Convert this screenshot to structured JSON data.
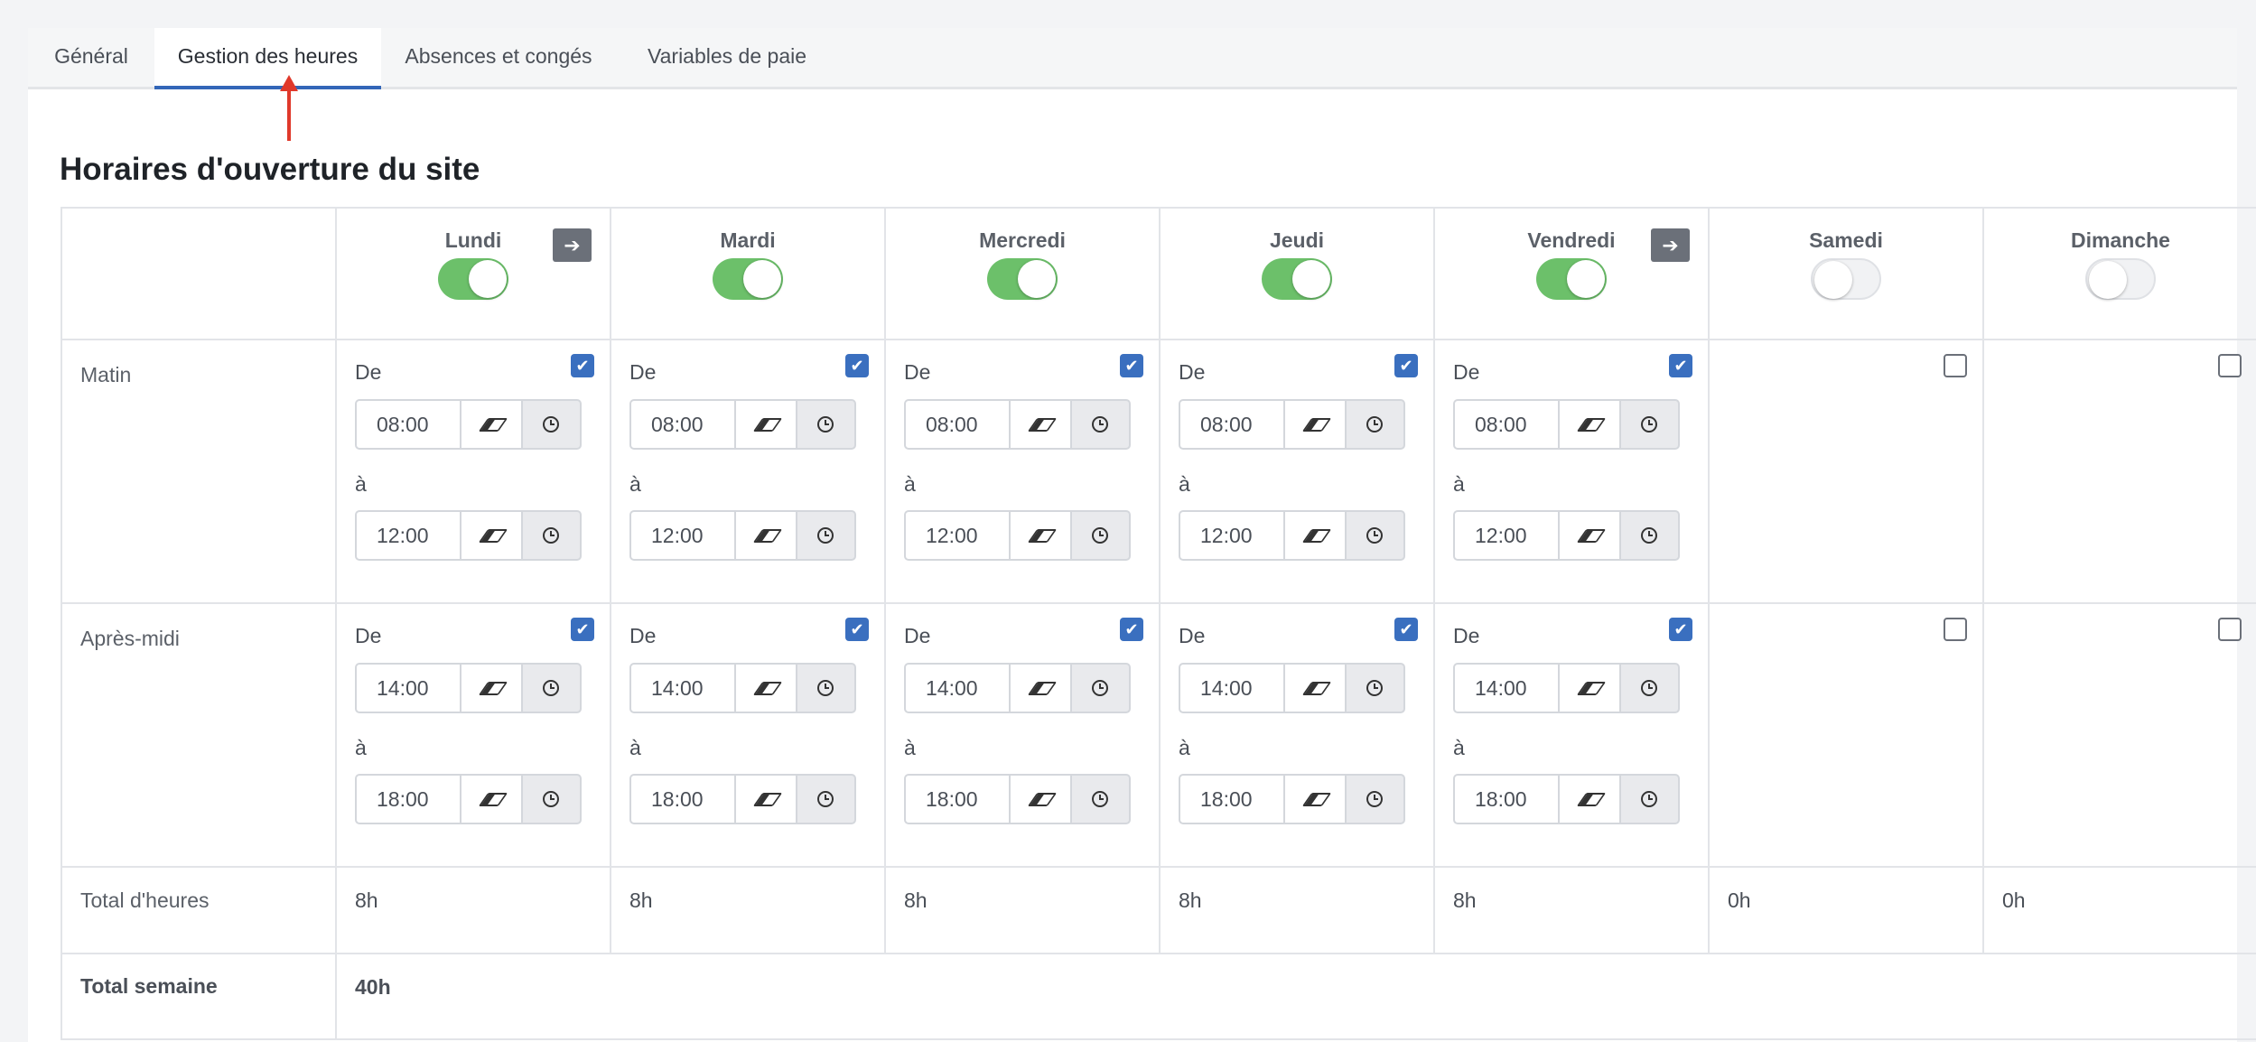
{
  "tabs": [
    "Général",
    "Gestion des heures",
    "Absences et congés",
    "Variables de paie"
  ],
  "active_tab": 1,
  "section_title": "Horaires d'ouverture du site",
  "row_labels": {
    "morning": "Matin",
    "afternoon": "Après-midi",
    "total": "Total d'heures",
    "week": "Total semaine"
  },
  "labels": {
    "from": "De",
    "to": "à"
  },
  "copy_icon": "arrow-right-icon",
  "days": [
    {
      "name": "Lundi",
      "enabled": true,
      "copy_button": true,
      "morning": {
        "checked": true,
        "from": "08:00",
        "to": "12:00"
      },
      "afternoon": {
        "checked": true,
        "from": "14:00",
        "to": "18:00"
      },
      "total": "8h"
    },
    {
      "name": "Mardi",
      "enabled": true,
      "copy_button": false,
      "morning": {
        "checked": true,
        "from": "08:00",
        "to": "12:00"
      },
      "afternoon": {
        "checked": true,
        "from": "14:00",
        "to": "18:00"
      },
      "total": "8h"
    },
    {
      "name": "Mercredi",
      "enabled": true,
      "copy_button": false,
      "morning": {
        "checked": true,
        "from": "08:00",
        "to": "12:00"
      },
      "afternoon": {
        "checked": true,
        "from": "14:00",
        "to": "18:00"
      },
      "total": "8h"
    },
    {
      "name": "Jeudi",
      "enabled": true,
      "copy_button": false,
      "morning": {
        "checked": true,
        "from": "08:00",
        "to": "12:00"
      },
      "afternoon": {
        "checked": true,
        "from": "14:00",
        "to": "18:00"
      },
      "total": "8h"
    },
    {
      "name": "Vendredi",
      "enabled": true,
      "copy_button": true,
      "morning": {
        "checked": true,
        "from": "08:00",
        "to": "12:00"
      },
      "afternoon": {
        "checked": true,
        "from": "14:00",
        "to": "18:00"
      },
      "total": "8h"
    },
    {
      "name": "Samedi",
      "enabled": false,
      "copy_button": false,
      "morning": {
        "checked": false
      },
      "afternoon": {
        "checked": false
      },
      "total": "0h"
    },
    {
      "name": "Dimanche",
      "enabled": false,
      "copy_button": false,
      "morning": {
        "checked": false
      },
      "afternoon": {
        "checked": false
      },
      "total": "0h"
    }
  ],
  "week_total": "40h",
  "colors": {
    "accent": "#3366b8",
    "toggle_on": "#6cc06a",
    "annotation_arrow": "#e0392b"
  }
}
